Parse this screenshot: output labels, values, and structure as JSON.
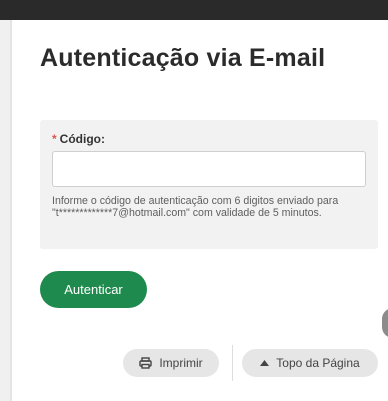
{
  "page": {
    "title": "Autenticação via E-mail"
  },
  "form": {
    "required_marker": "*",
    "code_label": "Código:",
    "code_value": "",
    "help_text": "Informe o código de autenticação com 6 digitos enviado para \"t*************7@hotmail.com\" com validade de 5 minutos."
  },
  "actions": {
    "authenticate_label": "Autenticar"
  },
  "footer": {
    "print_label": "Imprimir",
    "print_icon": "printer-icon",
    "top_label": "Topo da Página",
    "top_icon": "caret-up-icon"
  },
  "colors": {
    "accent": "#1f8a4e",
    "required": "#d9534f",
    "top_bar": "#2a2a2a",
    "panel": "#f2f2f2"
  }
}
